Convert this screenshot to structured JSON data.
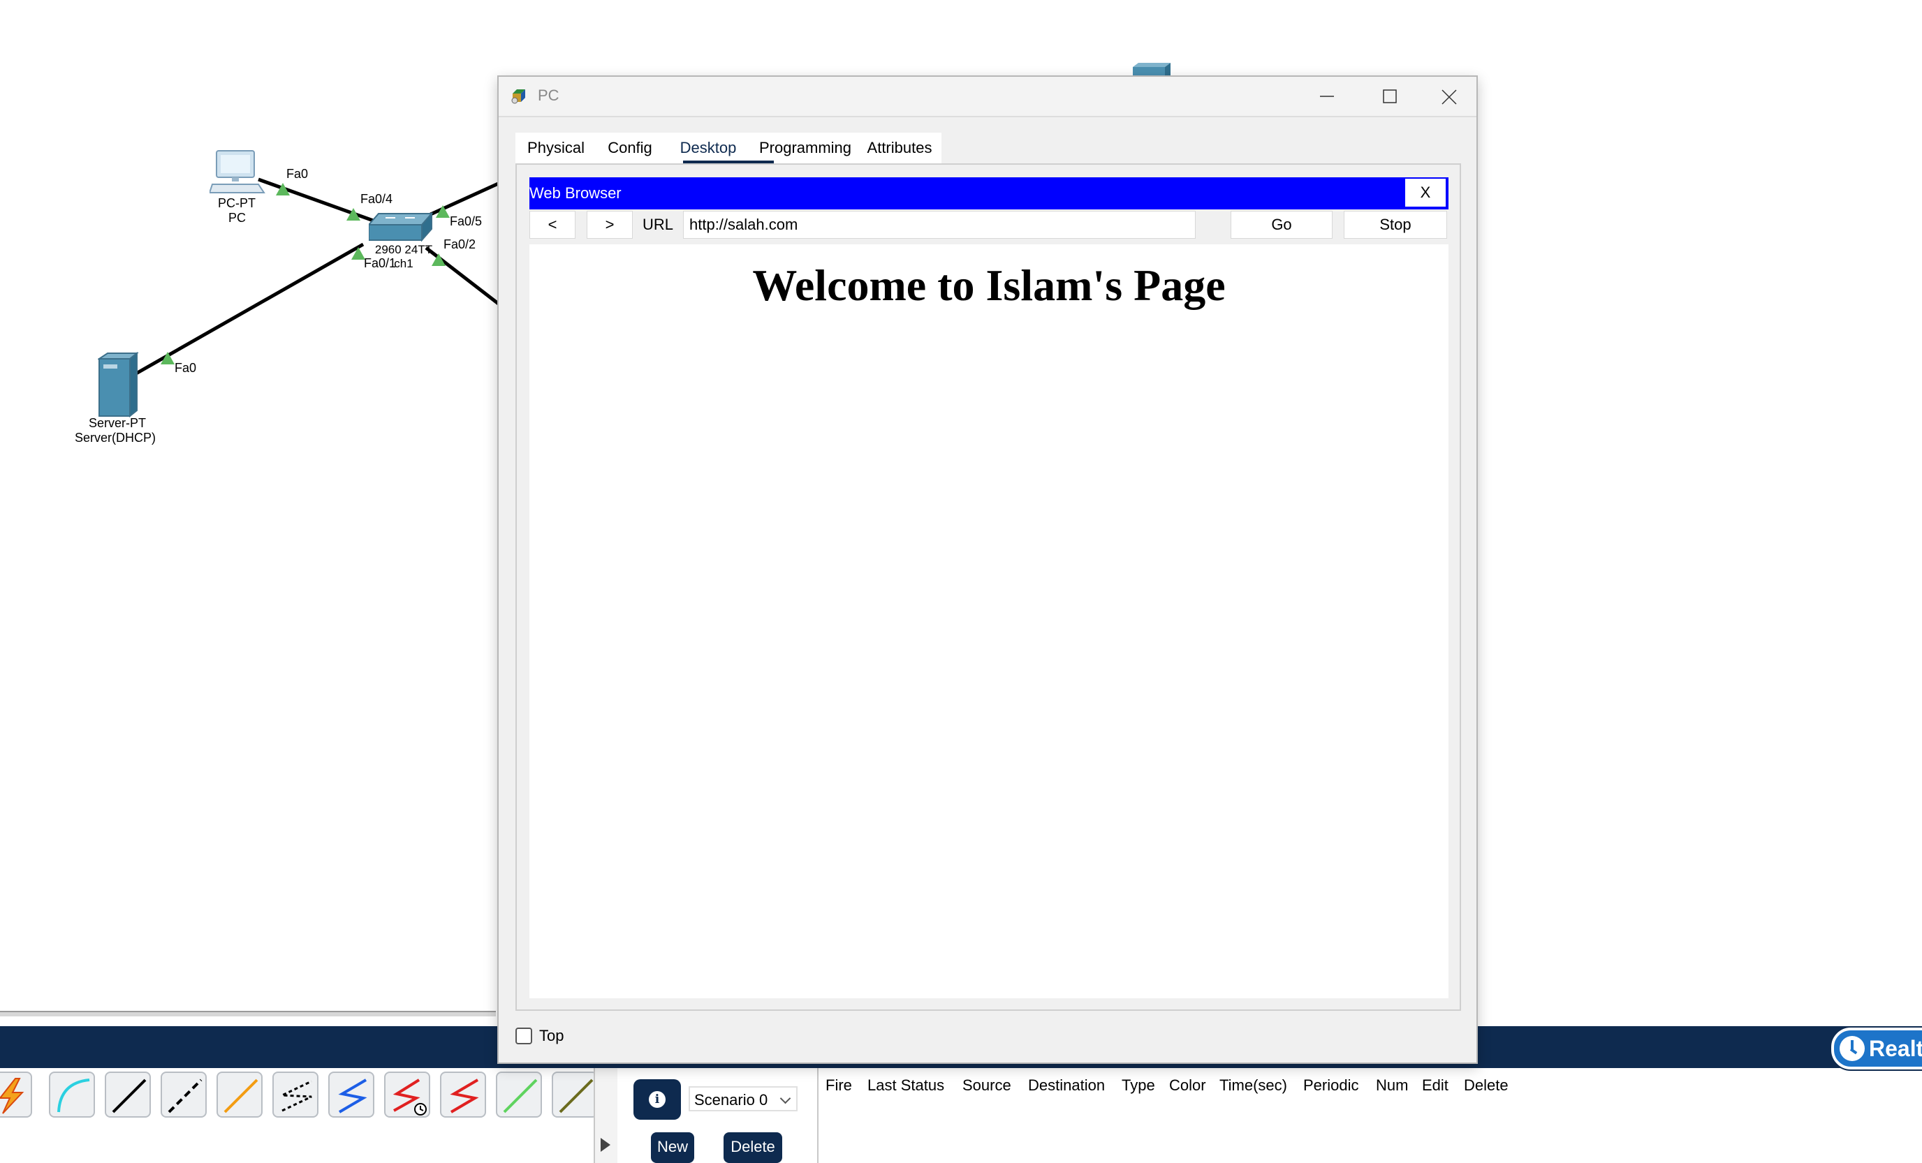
{
  "topology": {
    "devices": [
      {
        "model": "PC-PT",
        "name": "PC"
      },
      {
        "model": "2960-24TT",
        "name": "Switch1"
      },
      {
        "model": "Server-PT",
        "name": "Server(DHCP)"
      }
    ],
    "switch_label_visible": "2960 24TT ch1",
    "ports": [
      "Fa0",
      "Fa0/4",
      "Fa0/5",
      "Fa0/2",
      "Fa0/1",
      "Fa0"
    ]
  },
  "pc_window": {
    "title": "PC",
    "tabs": [
      {
        "label": "Physical"
      },
      {
        "label": "Config"
      },
      {
        "label": "Desktop",
        "active": true
      },
      {
        "label": "Programming"
      },
      {
        "label": "Attributes"
      }
    ],
    "web_browser": {
      "title": "Web Browser",
      "close_label": "X",
      "back_label": "<",
      "forward_label": ">",
      "url_label": "URL",
      "url_value": "http://salah.com",
      "go_label": "Go",
      "stop_label": "Stop",
      "page_heading": "Welcome to Islam's Page"
    },
    "top_checkbox": {
      "label": "Top",
      "checked": false
    }
  },
  "bottom": {
    "realtime_label": "Realti",
    "scenario_value": "Scenario 0",
    "new_label": "New",
    "delete_label": "Delete",
    "pdu_columns": [
      "Fire",
      "Last Status",
      "Source",
      "Destination",
      "Type",
      "Color",
      "Time(sec)",
      "Periodic",
      "Num",
      "Edit",
      "Delete"
    ],
    "connection_tools": [
      "automatic-connection",
      "console",
      "copper-straight-through",
      "copper-cross-over",
      "fiber",
      "phone",
      "coaxial",
      "serial-dce",
      "serial-dte",
      "octal",
      "iot-custom-cable"
    ]
  },
  "colors": {
    "accent_navy": "#0e2a4f",
    "browser_titlebar": "#0000ff",
    "realtime_blue": "#1d74c9",
    "port_link_green": "#5cb85c"
  }
}
